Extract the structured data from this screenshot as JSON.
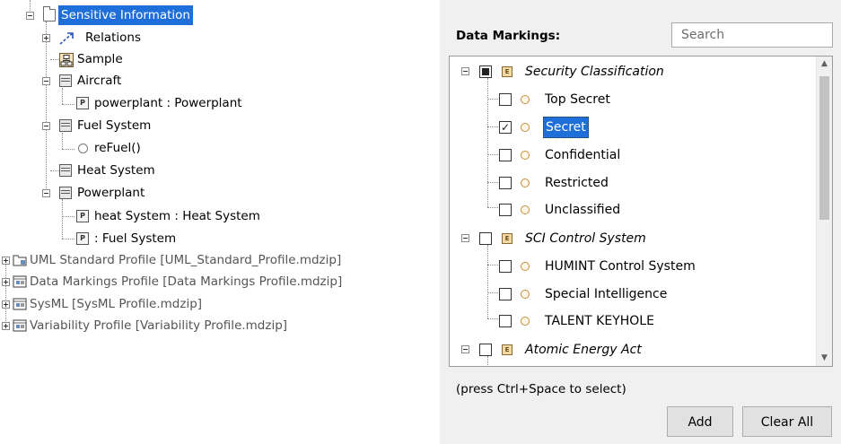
{
  "tree": {
    "items": [
      {
        "label": "Sensitive Information",
        "icon": "folder-icon",
        "selected": true
      },
      {
        "label": "Relations",
        "icon": "relations-icon"
      },
      {
        "label": "Sample",
        "icon": "diagram-icon"
      },
      {
        "label": "Aircraft",
        "icon": "block-icon"
      },
      {
        "label": "powerplant : Powerplant",
        "icon": "part-icon"
      },
      {
        "label": "Fuel System",
        "icon": "block-icon"
      },
      {
        "label": "reFuel()",
        "icon": "operation-icon"
      },
      {
        "label": "Heat System",
        "icon": "block-icon"
      },
      {
        "label": "Powerplant",
        "icon": "block-icon"
      },
      {
        "label": "heat System : Heat System",
        "icon": "part-icon"
      },
      {
        "label": " : Fuel System",
        "icon": "part-icon"
      },
      {
        "label": "UML Standard Profile [UML_Standard_Profile.mdzip]",
        "icon": "profile-folder-icon"
      },
      {
        "label": "Data Markings Profile [Data Markings Profile.mdzip]",
        "icon": "profile-icon"
      },
      {
        "label": "SysML [SysML Profile.mdzip]",
        "icon": "profile-icon"
      },
      {
        "label": "Variability Profile [Variability Profile.mdzip]",
        "icon": "profile-icon"
      }
    ],
    "part_glyph": "P",
    "enum_glyph": "E"
  },
  "data_markings": {
    "label": "Data Markings:",
    "search_placeholder": "Search",
    "items": [
      {
        "label": "Security Classification",
        "kind": "enumeration",
        "state": "partial"
      },
      {
        "label": "Top Secret",
        "kind": "literal",
        "state": "unchecked"
      },
      {
        "label": "Secret",
        "kind": "literal",
        "state": "checked",
        "selected": true
      },
      {
        "label": "Confidential",
        "kind": "literal",
        "state": "unchecked"
      },
      {
        "label": "Restricted",
        "kind": "literal",
        "state": "unchecked"
      },
      {
        "label": "Unclassified",
        "kind": "literal",
        "state": "unchecked"
      },
      {
        "label": "SCI Control System",
        "kind": "enumeration",
        "state": "unchecked"
      },
      {
        "label": "HUMINT Control System",
        "kind": "literal",
        "state": "unchecked"
      },
      {
        "label": "Special Intelligence",
        "kind": "literal",
        "state": "unchecked"
      },
      {
        "label": "TALENT KEYHOLE",
        "kind": "literal",
        "state": "unchecked"
      },
      {
        "label": "Atomic Energy Act",
        "kind": "enumeration",
        "state": "unchecked"
      }
    ],
    "hint": "(press Ctrl+Space to select)",
    "add_label": "Add",
    "clear_all_label": "Clear All"
  },
  "colors": {
    "selection": "#1e6fd9",
    "panel_bg": "#f0f0f0"
  }
}
